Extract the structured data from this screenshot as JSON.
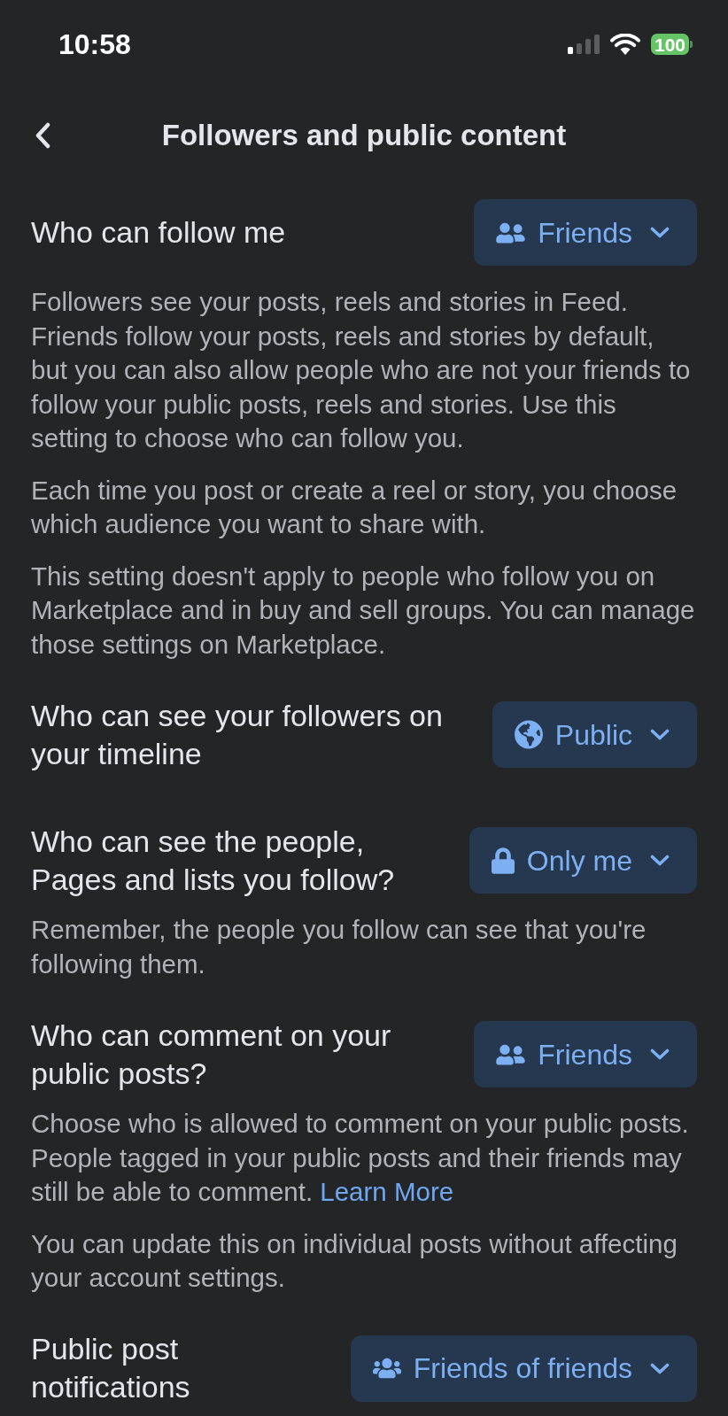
{
  "status_bar": {
    "time": "10:58",
    "battery": "100"
  },
  "header": {
    "title": "Followers and public content"
  },
  "sections": [
    {
      "title": "Who can follow me",
      "control": {
        "kind": "friends",
        "label": "Friends"
      },
      "paragraphs": [
        {
          "text": "Followers see your posts, reels and stories in Feed. Friends follow your posts, reels and stories by default, but you can also allow people who are not your friends to follow your public posts, reels and stories. Use this setting to choose who can follow you."
        },
        {
          "text": "Each time you post or create a reel or story, you choose which audience you want to share with."
        },
        {
          "text": "This setting doesn't apply to people who follow you on Marketplace and in buy and sell groups. You can manage those settings on Marketplace."
        }
      ]
    },
    {
      "title": "Who can see your followers on your timeline",
      "control": {
        "kind": "public",
        "label": "Public"
      }
    },
    {
      "title": "Who can see the people, Pages and lists you follow?",
      "control": {
        "kind": "only_me",
        "label": "Only me"
      },
      "paragraphs": [
        {
          "text": "Remember, the people you follow can see that you're following them."
        }
      ]
    },
    {
      "title": "Who can comment on your public posts?",
      "control": {
        "kind": "friends",
        "label": "Friends"
      },
      "paragraphs": [
        {
          "text": "Choose who is allowed to comment on your public posts. People tagged in your public posts and their friends may still be able to comment.",
          "link": "Learn More"
        },
        {
          "text": "You can update this on individual posts without affecting your account settings."
        }
      ]
    },
    {
      "title": "Public post notifications",
      "control": {
        "kind": "friends_of_friends",
        "label": "Friends of friends"
      }
    }
  ]
}
